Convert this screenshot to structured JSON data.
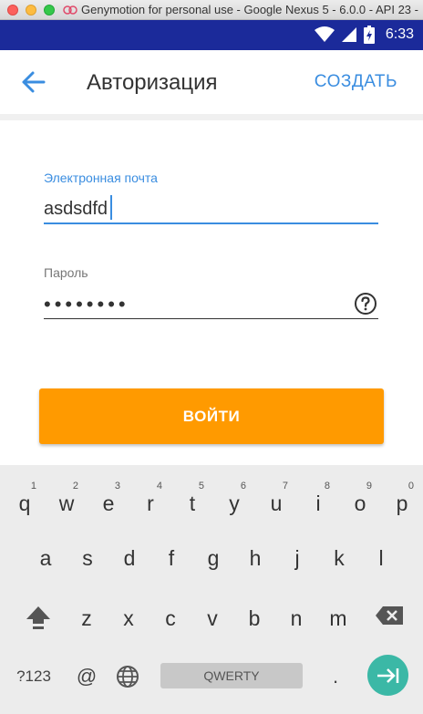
{
  "window": {
    "title": "Genymotion for personal use - Google Nexus 5 - 6.0.0 - API 23 -"
  },
  "status_bar": {
    "time": "6:33",
    "background": "#1b2a9a"
  },
  "toolbar": {
    "title": "Авторизация",
    "create_label": "СОЗДАТЬ"
  },
  "form": {
    "email_label": "Электронная почта",
    "email_value": "asdsdfd",
    "password_label": "Пароль",
    "password_value": "••••••••",
    "login_label": "ВОЙТИ"
  },
  "colors": {
    "accent": "#3a8de0",
    "button": "#ff9a00",
    "enter_key": "#3bb8a6"
  },
  "keyboard": {
    "row1": [
      {
        "ch": "q",
        "hint": "1"
      },
      {
        "ch": "w",
        "hint": "2"
      },
      {
        "ch": "e",
        "hint": "3"
      },
      {
        "ch": "r",
        "hint": "4"
      },
      {
        "ch": "t",
        "hint": "5"
      },
      {
        "ch": "y",
        "hint": "6"
      },
      {
        "ch": "u",
        "hint": "7"
      },
      {
        "ch": "i",
        "hint": "8"
      },
      {
        "ch": "o",
        "hint": "9"
      },
      {
        "ch": "p",
        "hint": "0"
      }
    ],
    "row2": [
      "a",
      "s",
      "d",
      "f",
      "g",
      "h",
      "j",
      "k",
      "l"
    ],
    "row3": [
      "z",
      "x",
      "c",
      "v",
      "b",
      "n",
      "m"
    ],
    "symbols_label": "?123",
    "at_label": "@",
    "space_label": "QWERTY",
    "period_label": "."
  }
}
